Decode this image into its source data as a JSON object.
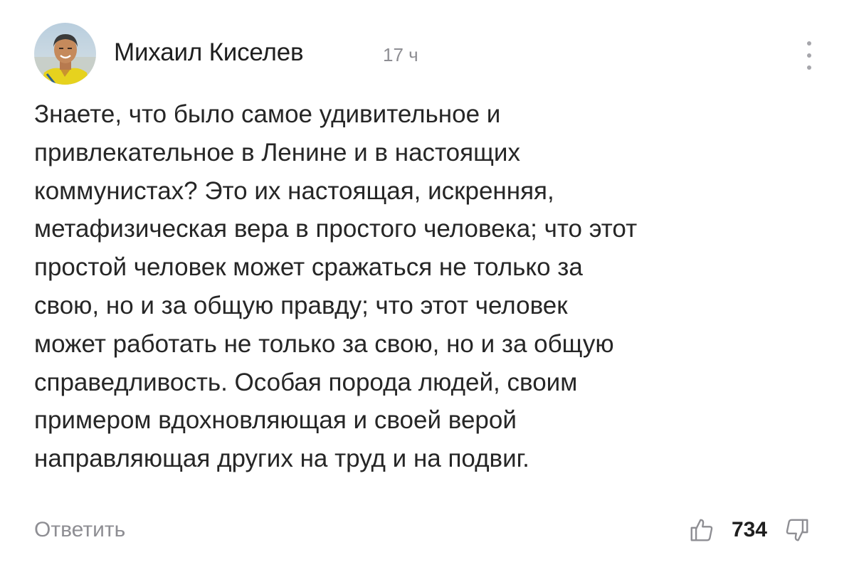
{
  "comment": {
    "author": "Михаил Киселев",
    "time": "17 ч",
    "text_lines": [
      "Знаете, что было самое удивительное и",
      "привлекательное в Ленине и в настоящих",
      "коммунистах? Это их настоящая, искренняя,",
      "метафизическая вера в простого человека; что этот",
      "простой человек может сражаться не только за",
      "свою, но и за общую правду; что этот человек",
      "может работать не только за свою, но и за общую",
      "справедливость. Особая порода людей, своим",
      "примером вдохновляющая и своей верой",
      "направляющая других на труд и на подвиг."
    ],
    "reply_label": "Ответить",
    "score": "734"
  },
  "icons": {
    "avatar": "avatar-photo",
    "more": "more-vertical-icon",
    "upvote": "thumb-up-icon",
    "downvote": "thumb-down-icon"
  },
  "colors": {
    "background": "#ffffff",
    "text": "#262626",
    "muted": "#8e8e93",
    "icon": "#8e8e93"
  }
}
